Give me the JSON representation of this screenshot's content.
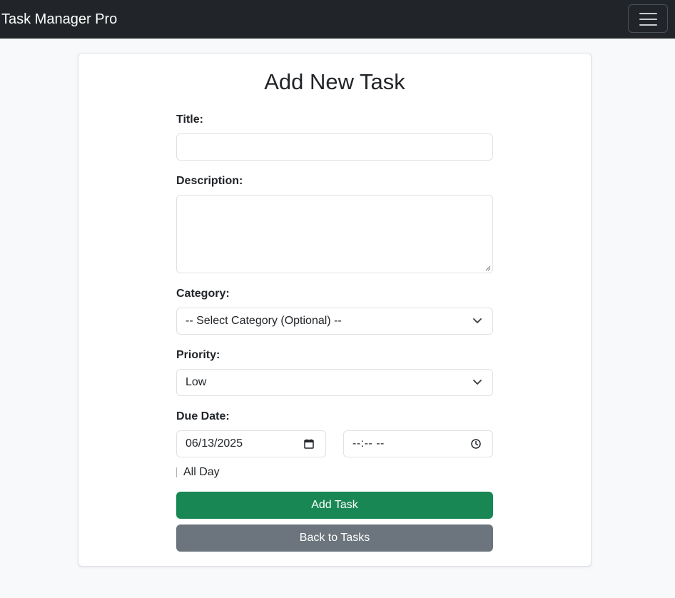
{
  "navbar": {
    "brand": "Task Manager Pro"
  },
  "form": {
    "title": "Add New Task",
    "title_label": "Title:",
    "title_value": "",
    "description_label": "Description:",
    "description_value": "",
    "category_label": "Category:",
    "category_selected": "-- Select Category (Optional) --",
    "priority_label": "Priority:",
    "priority_selected": "Low",
    "due_date_label": "Due Date:",
    "due_date_value": "06/13/2025",
    "due_time_value": "--:-- --",
    "all_day_label": "All Day",
    "add_button": "Add Task",
    "back_button": "Back to Tasks"
  },
  "colors": {
    "navbar_bg": "#212529",
    "success": "#198754",
    "secondary": "#6c757d",
    "page_bg": "#f8f9fa"
  }
}
